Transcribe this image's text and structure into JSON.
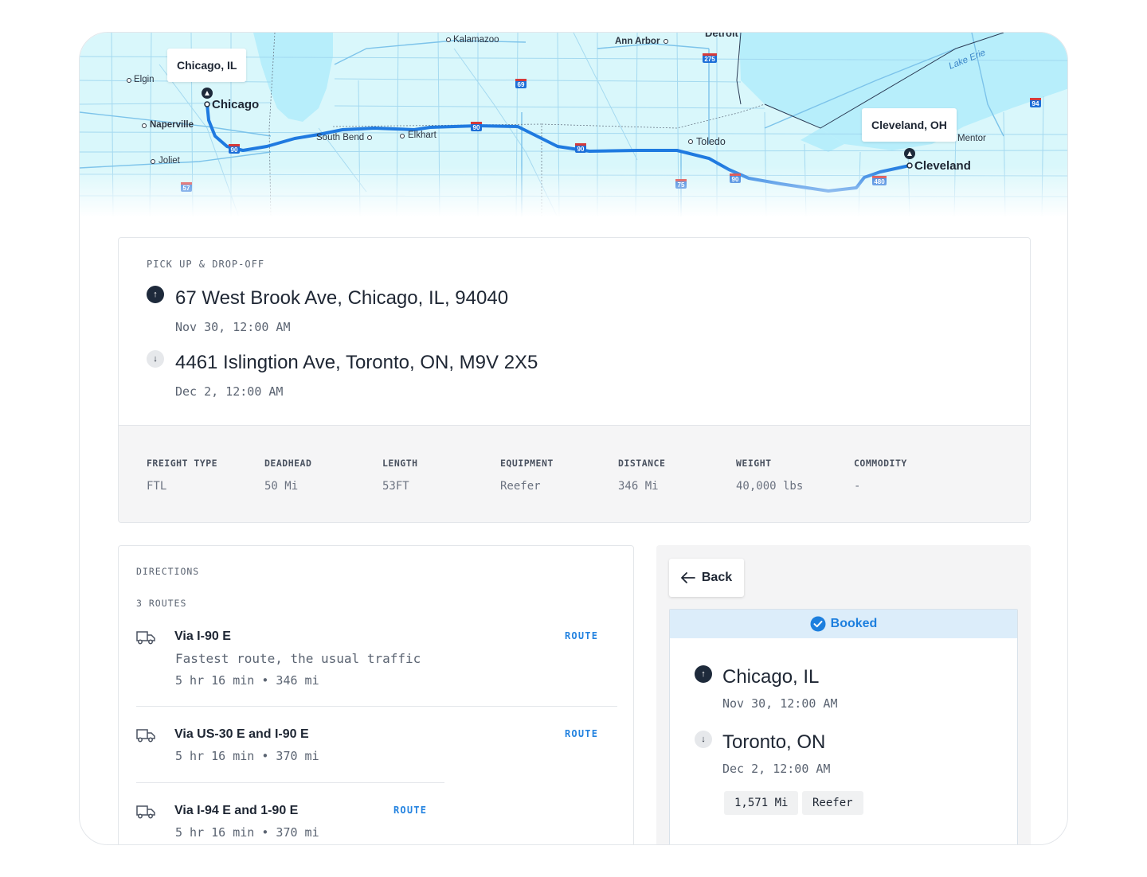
{
  "map": {
    "origin_label": "Chicago, IL",
    "destination_label": "Cleveland, OH",
    "cities": {
      "chicago": "Chicago",
      "cleveland": "Cleveland"
    },
    "towns": {
      "elgin": "Elgin",
      "naperville": "Naperville",
      "joliet": "Joliet",
      "kalamazoo": "Kalamazoo",
      "ann_arbor": "Ann Arbor",
      "detroit": "Detroit",
      "south_bend": "South Bend",
      "elkhart": "Elkhart",
      "toledo": "Toledo",
      "mentor": "Mentor",
      "lake_erie": "Lake Erie"
    },
    "shields": [
      "69",
      "275",
      "90",
      "90",
      "94",
      "90",
      "75",
      "90",
      "480",
      "57"
    ]
  },
  "pickup": {
    "section_label": "PICK UP & DROP-OFF",
    "origin_address": "67 West Brook Ave, Chicago, IL, 94040",
    "origin_time": "Nov 30, 12:00 AM",
    "destination_address": "4461 Islingtion Ave, Toronto, ON, M9V 2X5",
    "destination_time": "Dec 2, 12:00 AM",
    "up_arrow": "↑",
    "down_arrow": "↓"
  },
  "specs": [
    {
      "label": "FREIGHT TYPE",
      "value": "FTL"
    },
    {
      "label": "DEADHEAD",
      "value": "50 Mi"
    },
    {
      "label": "LENGTH",
      "value": "53FT"
    },
    {
      "label": "EQUIPMENT",
      "value": "Reefer"
    },
    {
      "label": "DISTANCE",
      "value": "346 Mi"
    },
    {
      "label": "WEIGHT",
      "value": "40,000 lbs"
    },
    {
      "label": "COMMODITY",
      "value": "-"
    }
  ],
  "directions": {
    "section_label": "DIRECTIONS",
    "count_label": "3 ROUTES",
    "routes": [
      {
        "title": "Via I-90 E",
        "description": "Fastest route, the usual traffic",
        "meta": "5 hr 16 min • 346 mi",
        "action": "ROUTE"
      },
      {
        "title": "Via US-30 E and I-90 E",
        "meta": "5 hr 16 min • 370 mi",
        "action": "ROUTE"
      },
      {
        "title": "Via I-94 E and 1-90 E",
        "meta": "5 hr 16 min • 370 mi",
        "action": "ROUTE"
      }
    ]
  },
  "booking": {
    "back_label": "Back",
    "status": "Booked",
    "origin_city": "Chicago, IL",
    "origin_time": "Nov 30, 12:00 AM",
    "destination_city": "Toronto, ON",
    "destination_time": "Dec 2, 12:00 AM",
    "chips": [
      "1,571 Mi",
      "Reefer"
    ]
  },
  "colors": {
    "accent": "#2483e0",
    "route_line": "#1f7ae0",
    "water": "#b7eefb",
    "land": "#d9f7fb",
    "dark": "#1e2a3b"
  }
}
